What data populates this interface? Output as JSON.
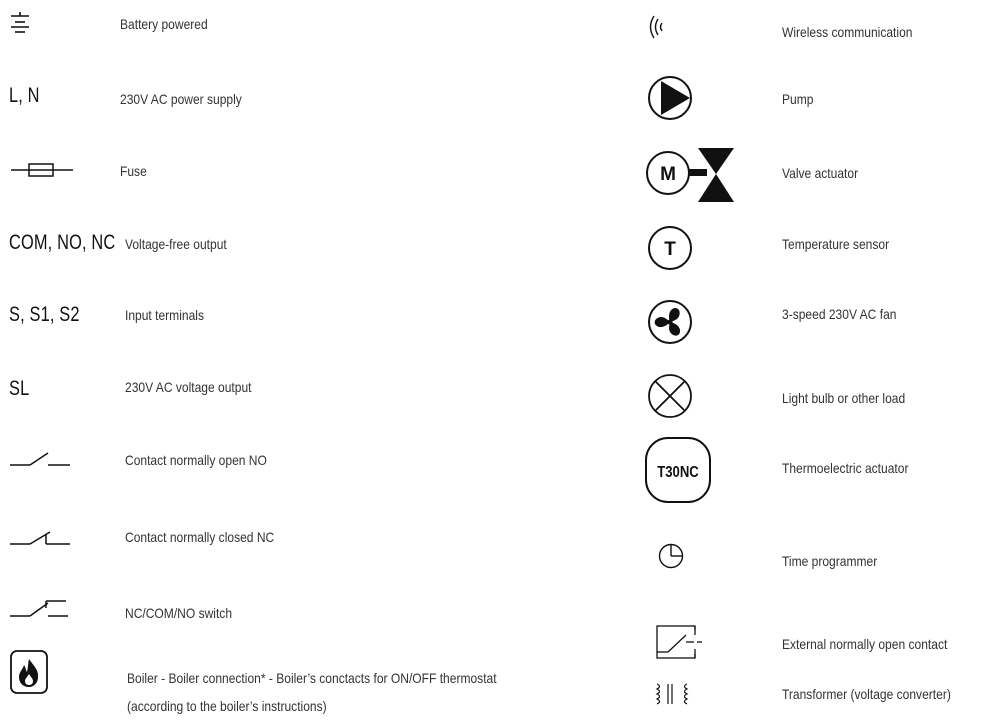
{
  "left_column": [
    {
      "symbol": "",
      "label": "Battery powered",
      "icon": "battery-icon"
    },
    {
      "symbol": "L, N",
      "label": "230V AC power supply"
    },
    {
      "symbol": "",
      "label": "Fuse",
      "icon": "fuse-icon"
    },
    {
      "symbol": "COM, NO, NC",
      "label": "Voltage-free output"
    },
    {
      "symbol": "S, S1, S2",
      "label": "Input terminals"
    },
    {
      "symbol": "SL",
      "label": "230V AC voltage output"
    },
    {
      "symbol": "",
      "label": "Contact normally open NO",
      "icon": "contact-no-icon"
    },
    {
      "symbol": "",
      "label": "Contact normally closed NC",
      "icon": "contact-nc-icon"
    },
    {
      "symbol": "",
      "label": "NC/COM/NO switch",
      "icon": "switch-icon"
    },
    {
      "symbol": "",
      "label_line1": "Boiler - Boiler connection* - Boiler’s conctacts for ON/OFF thermostat",
      "label_line2": "(according to the boiler’s instructions)",
      "icon": "boiler-flame-icon"
    }
  ],
  "right_column": [
    {
      "label": "Wireless communication",
      "icon": "wireless-icon"
    },
    {
      "label": "Pump",
      "icon": "pump-icon"
    },
    {
      "label": "Valve actuator",
      "icon": "valve-actuator-icon",
      "icon_text": "M"
    },
    {
      "label": "Temperature sensor",
      "icon": "temperature-sensor-icon",
      "icon_text": "T"
    },
    {
      "label": "3-speed 230V AC fan",
      "icon": "fan-icon"
    },
    {
      "label": "Light bulb or other load",
      "icon": "light-bulb-icon"
    },
    {
      "label": "Thermoelectric actuator",
      "icon": "thermoelectric-actuator-icon",
      "icon_text": "T30NC"
    },
    {
      "label": "Time programmer",
      "icon": "clock-icon"
    },
    {
      "label": "External normally open contact",
      "icon": "external-contact-icon"
    },
    {
      "label": "Transformer (voltage converter)",
      "icon": "transformer-icon"
    }
  ],
  "colors": {
    "ink": "#111111",
    "text": "#333333",
    "background": "#ffffff"
  }
}
